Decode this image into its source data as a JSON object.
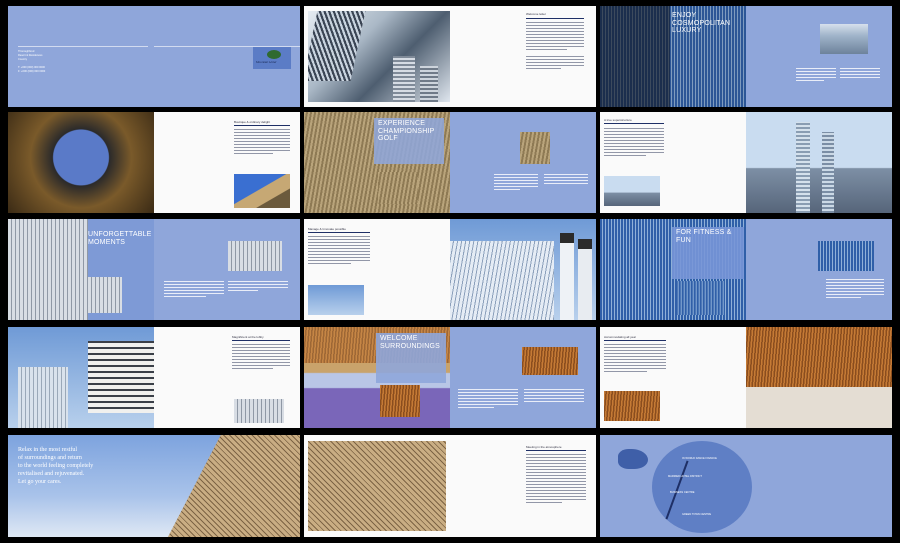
{
  "spread1": {
    "address": [
      "Thoroughbred",
      "Resort & Residences",
      "Country"
    ],
    "contact": [
      "T: +000 (000) 000 0000",
      "F: +000 (000) 000 0000"
    ],
    "logo_text": "Mountain Hotel"
  },
  "spread2": {
    "heading": "Welcome letter"
  },
  "spread3": {
    "heading": "ENJOY COSMOPOLITAN LUXURY"
  },
  "spread4": {
    "heading": "Boutique & ordinary delight"
  },
  "spread5": {
    "heading": "EXPERIENCE CHAMPIONSHIP GOLF"
  },
  "spread6": {
    "heading": "A true superstructure"
  },
  "spread7": {
    "heading": "UNFORGETTABLE MOMENTS"
  },
  "spread8": {
    "heading": "Manage & Innovate possible"
  },
  "spread9": {
    "heading": "FOR FITNESS & FUN"
  },
  "spread10": {
    "heading": "Magnificent at the lobby"
  },
  "spread11": {
    "heading": "WELCOME SURROUNDINGS"
  },
  "spread12": {
    "heading": "Accommodating all year"
  },
  "spread13": {
    "tagline": [
      "Relax in the most restful",
      "of surroundings and return",
      "to the world feeling completely",
      "revitalised and rejuvenated.",
      "Let go your cares."
    ]
  },
  "spread14": {
    "heading": "Meeting in the atmosphere"
  },
  "spread15": {
    "map_labels": [
      "IN WORLD DANCE FINANCE",
      "MARRIED HOTEL DISTRICT",
      "BUSINESS CENTRE",
      "GREEN TOWN CENTRE"
    ]
  },
  "colors": {
    "page_blue": "#8fa6da",
    "navy_rule": "#1e2f66",
    "background": "#000000"
  }
}
